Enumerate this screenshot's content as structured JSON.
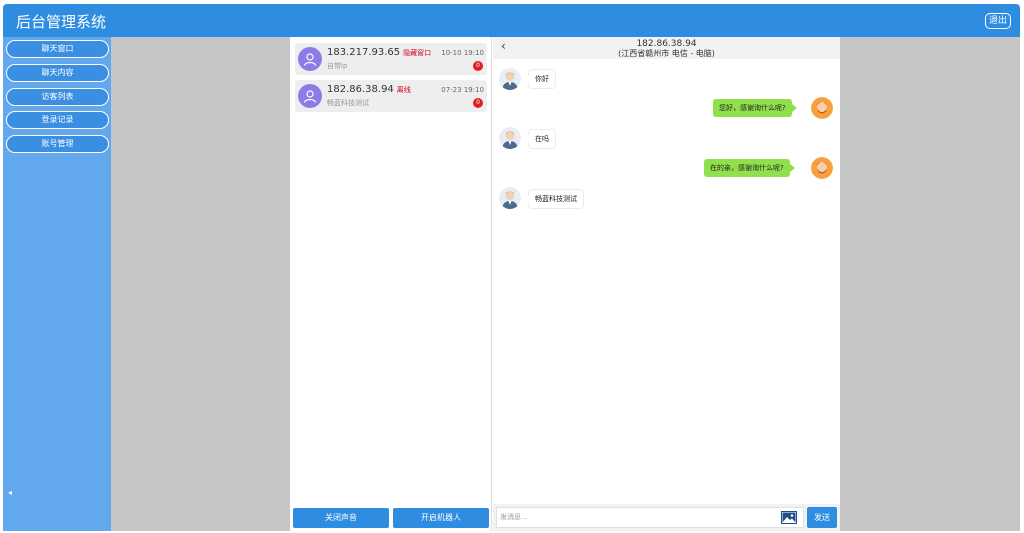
{
  "app": {
    "title": "后台管理系统",
    "logout_label": "退出"
  },
  "sidebar": {
    "items": [
      {
        "label": "聊天窗口"
      },
      {
        "label": "聊天内容"
      },
      {
        "label": "访客列表"
      },
      {
        "label": "登录记录"
      },
      {
        "label": "账号管理"
      }
    ],
    "collapse_icon": "◂"
  },
  "conversations": [
    {
      "ip": "183.217.93.65",
      "tag": "隐藏窗口",
      "sub": "自带ip",
      "time": "10-10 19:10",
      "unread": "0"
    },
    {
      "ip": "182.86.38.94",
      "tag": "离线",
      "sub": "畅蓝科技测试",
      "time": "07-23 19:10",
      "unread": "0"
    }
  ],
  "actions": {
    "mute_label": "关闭声音",
    "robot_label": "开启机器人"
  },
  "chat": {
    "back_icon": "‹",
    "ip": "182.86.38.94",
    "location": "(江西省赣州市 电信 - 电脑)",
    "messages": [
      {
        "side": "left",
        "text": "你好"
      },
      {
        "side": "right",
        "text": "您好，感谢询什么呢?"
      },
      {
        "side": "left",
        "text": "在吗"
      },
      {
        "side": "right",
        "text": "在的亲，感谢询什么呢?"
      },
      {
        "side": "left",
        "text": "畅蓝科技测试"
      }
    ],
    "input_placeholder": "发消息...",
    "send_label": "发送"
  },
  "colors": {
    "primary": "#2e8de0",
    "sidebar": "#62a8ed",
    "bubble_right": "#8fe04c",
    "badge": "#e02020"
  }
}
